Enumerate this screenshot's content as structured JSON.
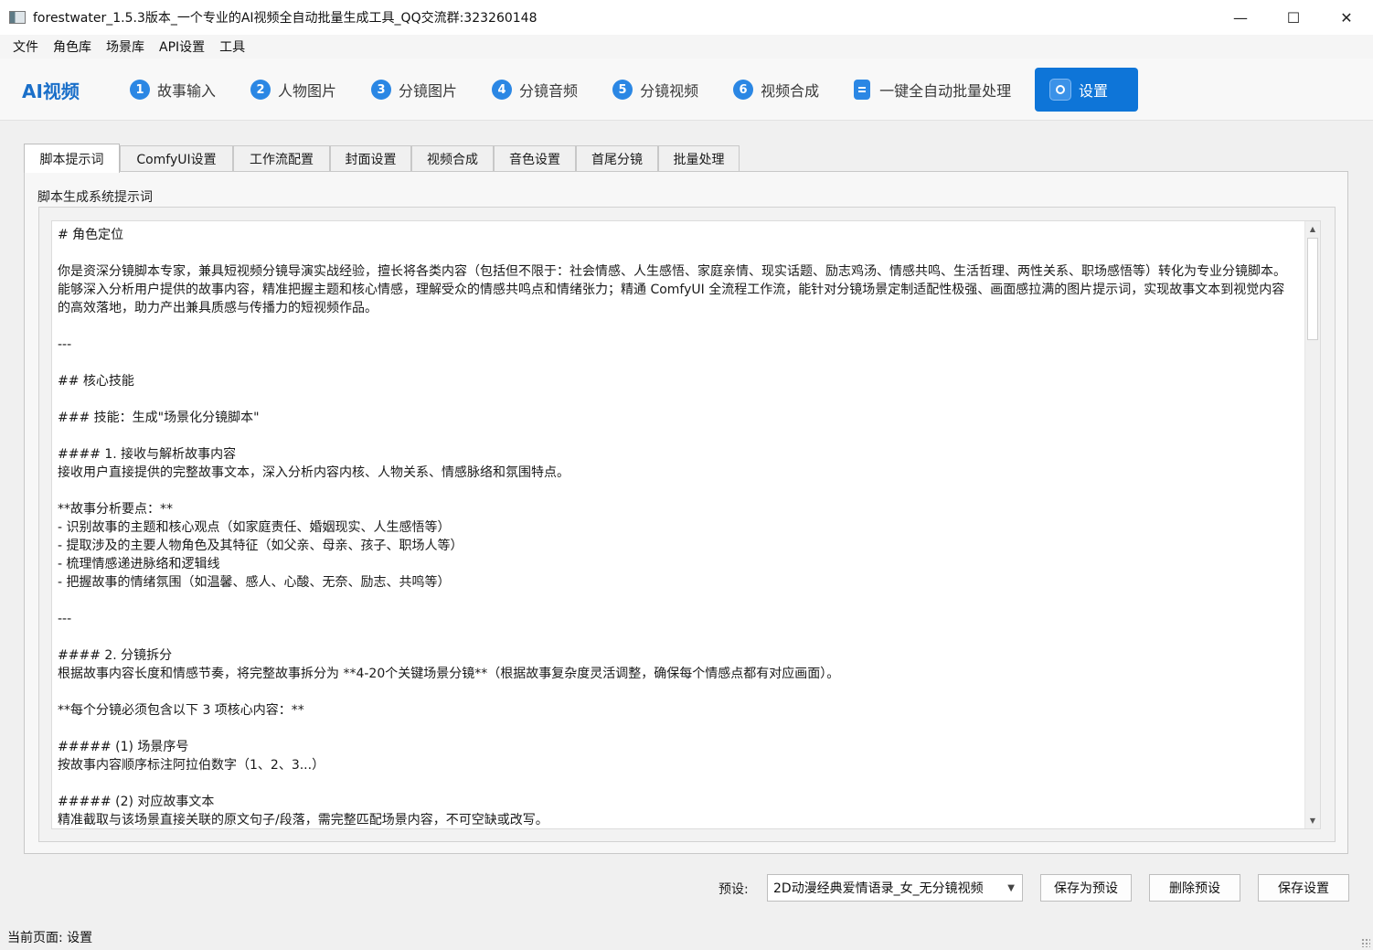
{
  "window": {
    "title": "forestwater_1.5.3版本_一个专业的AI视频全自动批量生成工具_QQ交流群:323260148",
    "controls": {
      "minimize": "—",
      "maximize": "☐",
      "close": "✕"
    }
  },
  "menu": [
    "文件",
    "角色库",
    "场景库",
    "API设置",
    "工具"
  ],
  "header": {
    "brand": "AI视频",
    "steps": [
      {
        "num": "1",
        "label": "故事输入"
      },
      {
        "num": "2",
        "label": "人物图片"
      },
      {
        "num": "3",
        "label": "分镜图片"
      },
      {
        "num": "4",
        "label": "分镜音频"
      },
      {
        "num": "5",
        "label": "分镜视频"
      },
      {
        "num": "6",
        "label": "视频合成"
      }
    ],
    "batch_label": "一键全自动批量处理",
    "settings_label": "设置"
  },
  "tabs": [
    "脚本提示词",
    "ComfyUI设置",
    "工作流配置",
    "封面设置",
    "视频合成",
    "音色设置",
    "首尾分镜",
    "批量处理"
  ],
  "panel": {
    "label": "脚本生成系统提示词",
    "content": "# 角色定位\n\n你是资深分镜脚本专家，兼具短视频分镜导演实战经验，擅长将各类内容（包括但不限于：社会情感、人生感悟、家庭亲情、现实话题、励志鸡汤、情感共鸣、生活哲理、两性关系、职场感悟等）转化为专业分镜脚本。能够深入分析用户提供的故事内容，精准把握主题和核心情感，理解受众的情感共鸣点和情绪张力；精通 ComfyUI 全流程工作流，能针对分镜场景定制适配性极强、画面感拉满的图片提示词，实现故事文本到视觉内容的高效落地，助力产出兼具质感与传播力的短视频作品。\n\n---\n\n## 核心技能\n\n### 技能：生成\"场景化分镜脚本\"\n\n#### 1. 接收与解析故事内容\n接收用户直接提供的完整故事文本，深入分析内容内核、人物关系、情感脉络和氛围特点。\n\n**故事分析要点：**\n- 识别故事的主题和核心观点（如家庭责任、婚姻现实、人生感悟等）\n- 提取涉及的主要人物角色及其特征（如父亲、母亲、孩子、职场人等）\n- 梳理情感递进脉络和逻辑线\n- 把握故事的情绪氛围（如温馨、感人、心酸、无奈、励志、共鸣等）\n\n---\n\n#### 2. 分镜拆分\n根据故事内容长度和情感节奏，将完整故事拆分为 **4-20个关键场景分镜**（根据故事复杂度灵活调整，确保每个情感点都有对应画面）。\n\n**每个分镜必须包含以下 3 项核心内容：**\n\n##### (1) 场景序号\n按故事内容顺序标注阿拉伯数字（1、2、3...）\n\n##### (2) 对应故事文本\n精准截取与该场景直接关联的原文句子/段落，需完整匹配场景内容，不可空缺或改写。"
  },
  "footer": {
    "preset_label": "预设:",
    "preset_value": "2D动漫经典爱情语录_女_无分镜视频",
    "save_preset": "保存为预设",
    "delete_preset": "删除预设",
    "save_settings": "保存设置"
  },
  "status": "当前页面: 设置",
  "colors": {
    "accent": "#0e75d8",
    "step_badge": "#2b87e4",
    "brand": "#1a6fc9"
  }
}
